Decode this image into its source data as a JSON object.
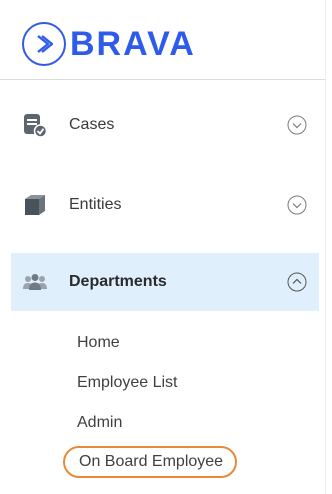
{
  "brand": {
    "name": "BRAVA",
    "accent_color": "#2f5bea",
    "icon": "brava-logo-icon"
  },
  "nav": {
    "items": [
      {
        "label": "Cases",
        "icon": "cases-icon",
        "chevron": "chevron-down-icon",
        "expanded": false
      },
      {
        "label": "Entities",
        "icon": "entities-icon",
        "chevron": "chevron-down-icon",
        "expanded": false
      },
      {
        "label": "Departments",
        "icon": "departments-icon",
        "chevron": "chevron-up-icon",
        "expanded": true
      }
    ],
    "active_color": "#dfeffc"
  },
  "departments": {
    "subitems": [
      {
        "label": "Home"
      },
      {
        "label": "Employee List"
      },
      {
        "label": "Admin"
      },
      {
        "label": "On Board Employee"
      }
    ],
    "highlight_color": "#e8893a"
  }
}
